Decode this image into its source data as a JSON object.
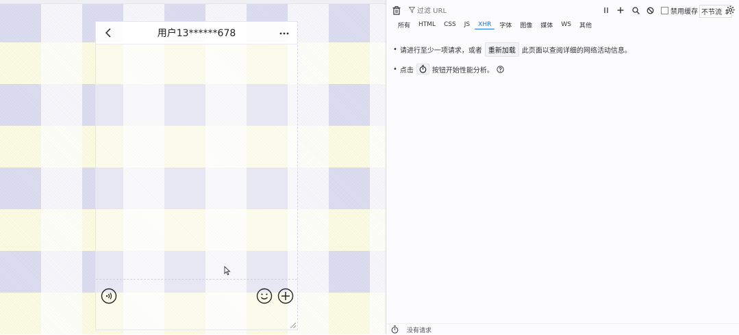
{
  "phone": {
    "chat_title": "用户13******678",
    "icons": {
      "back": "chevron-left-icon",
      "more": "more-dots-icon",
      "voice": "voice-icon",
      "emoji": "smiley-icon",
      "plus": "plus-circle-icon"
    }
  },
  "devtools": {
    "toolbar": {
      "filter_placeholder": "过滤 URL",
      "disable_cache_label": "禁用缓存",
      "throttle_label": "不节流"
    },
    "tabs": [
      {
        "label": "所有"
      },
      {
        "label": "HTML"
      },
      {
        "label": "CSS"
      },
      {
        "label": "JS"
      },
      {
        "label": "XHR",
        "active": true
      },
      {
        "label": "字体"
      },
      {
        "label": "图像"
      },
      {
        "label": "媒体"
      },
      {
        "label": "WS"
      },
      {
        "label": "其他"
      }
    ],
    "message1": {
      "bullet": "•",
      "before": "请进行至少一项请求，或者",
      "button": "重新加载",
      "after": "此页面以查阅详细的网络活动信息。"
    },
    "message2": {
      "bullet": "•",
      "before": "点击",
      "after": "按钮开始性能分析。"
    },
    "status": {
      "text": "没有请求"
    }
  },
  "colors": {
    "accent": "#1a73e8",
    "viewport_yellow": "#fbfbe3",
    "viewport_lavender": "#dcdcf0"
  }
}
